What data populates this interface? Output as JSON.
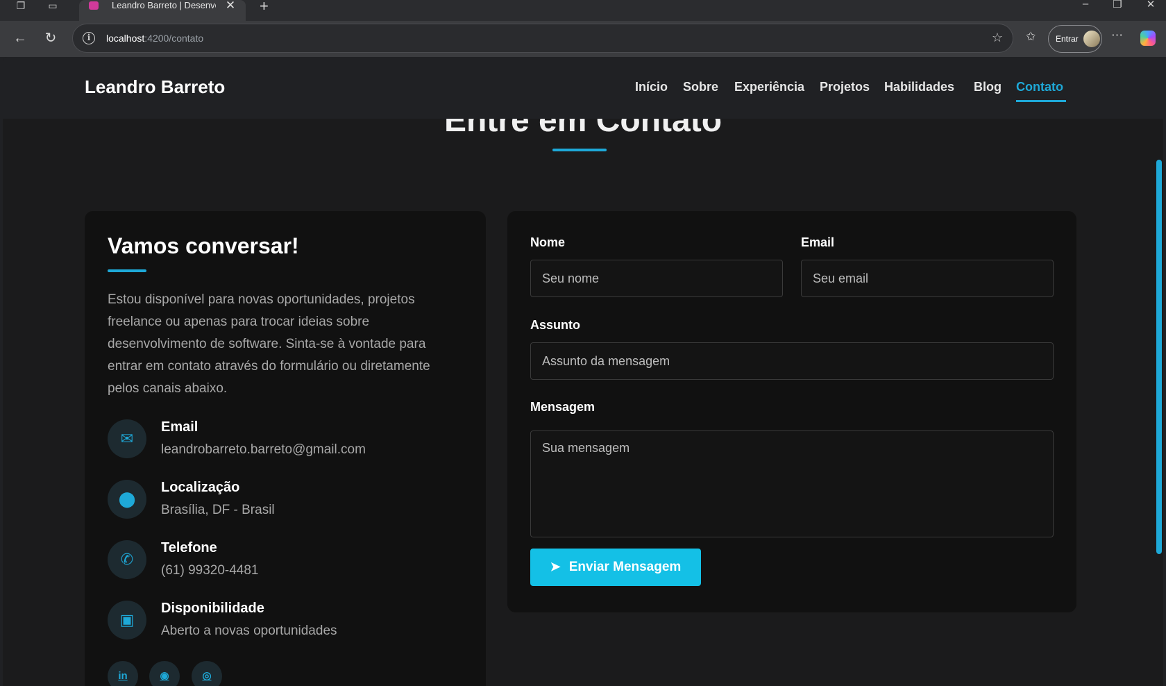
{
  "browser": {
    "tab_title": "Leandro Barreto | Desenvolv",
    "url_host": "localhost",
    "url_path": ":4200/contato",
    "profile_label": "Entrar"
  },
  "header": {
    "brand": "Leandro Barreto",
    "nav": [
      "Início",
      "Sobre",
      "Experiência",
      "Projetos",
      "Habilidades",
      "Blog",
      "Contato"
    ],
    "active": "Contato"
  },
  "section": {
    "title": "Entre em Contato"
  },
  "contact": {
    "heading": "Vamos conversar!",
    "intro": "Estou disponível para novas oportunidades, projetos freelance ou apenas para trocar ideias sobre desenvolvimento de software. Sinta-se à vontade para entrar em contato através do formulário ou diretamente pelos canais abaixo.",
    "items": [
      {
        "label": "Email",
        "value": "leandrobarreto.barreto@gmail.com",
        "icon": "envelope-icon"
      },
      {
        "label": "Localização",
        "value": "Brasília, DF - Brasil",
        "icon": "map-pin-icon"
      },
      {
        "label": "Telefone",
        "value": "(61) 99320-4481",
        "icon": "phone-icon"
      },
      {
        "label": "Disponibilidade",
        "value": "Aberto a novas oportunidades",
        "icon": "briefcase-icon"
      }
    ],
    "social": [
      "linkedin-icon",
      "github-icon",
      "instagram-icon"
    ]
  },
  "form": {
    "name_label": "Nome",
    "name_placeholder": "Seu nome",
    "email_label": "Email",
    "email_placeholder": "Seu email",
    "subject_label": "Assunto",
    "subject_placeholder": "Assunto da mensagem",
    "message_label": "Mensagem",
    "message_placeholder": "Sua mensagem",
    "submit_label": "Enviar Mensagem"
  },
  "colors": {
    "accent": "#1ea9d8",
    "button": "#14c0e6",
    "background": "#1b1b1c",
    "card": "#111111"
  }
}
